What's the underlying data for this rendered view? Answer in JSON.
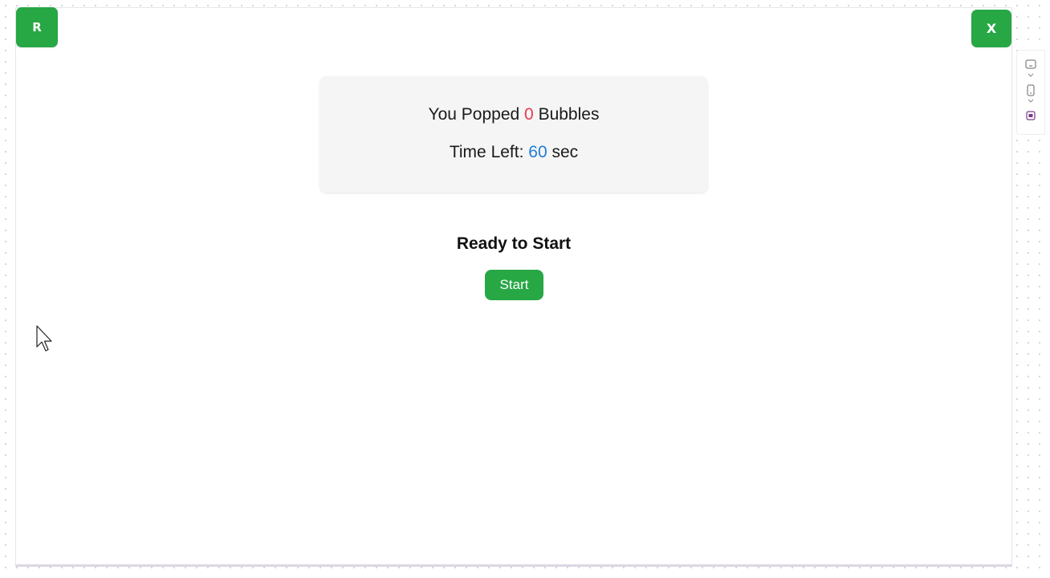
{
  "corner_buttons": {
    "reset_label": "R",
    "close_label": "X"
  },
  "score_panel": {
    "popped_prefix": "You Popped ",
    "popped_count": "0",
    "popped_suffix": " Bubbles",
    "time_prefix": "Time Left: ",
    "time_value": "60",
    "time_suffix": " sec"
  },
  "status": {
    "title": "Ready to Start",
    "start_label": "Start"
  },
  "side_toolbar": {
    "items": [
      {
        "icon": "desktop-view-icon"
      },
      {
        "icon": "mobile-view-icon"
      },
      {
        "icon": "app-badge-icon"
      }
    ]
  },
  "colors": {
    "accent_green": "#28a745",
    "count_red": "#e8394c",
    "time_blue": "#1f7ed6",
    "panel_bg": "#f5f5f5"
  }
}
